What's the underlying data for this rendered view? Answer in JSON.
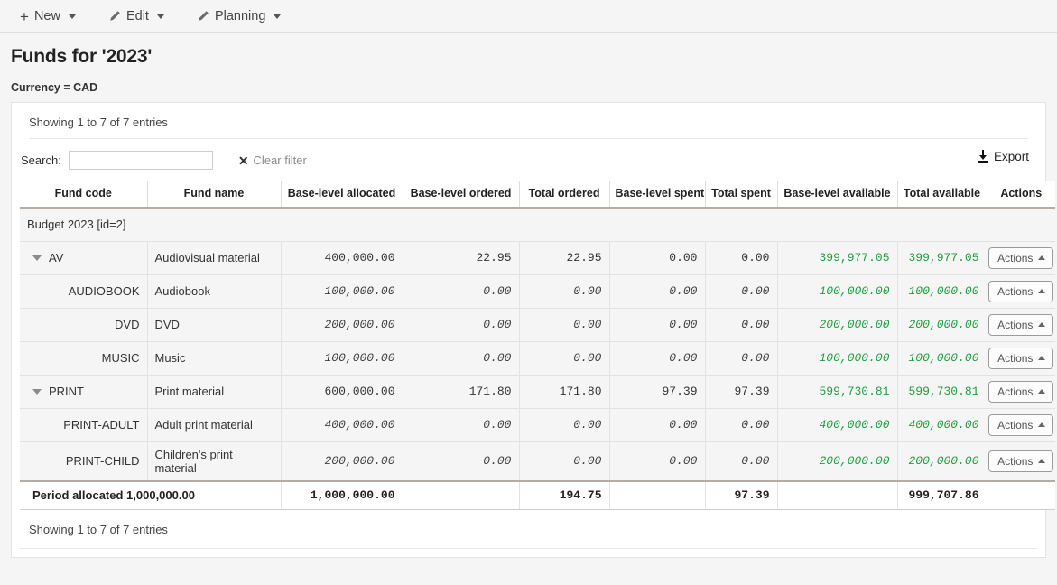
{
  "toolbar": {
    "items": [
      {
        "label": "New",
        "icon": "plus-icon"
      },
      {
        "label": "Edit",
        "icon": "pencil-icon"
      },
      {
        "label": "Planning",
        "icon": "pencil-icon"
      }
    ]
  },
  "header": {
    "title": "Funds for '2023'",
    "currency": "Currency = CAD"
  },
  "panel": {
    "showing_top": "Showing 1 to 7 of 7 entries",
    "showing_bottom": "Showing 1 to 7 of 7 entries",
    "search_label": "Search:",
    "search_value": "",
    "search_placeholder": "",
    "clear_filter": "Clear filter",
    "export": "Export"
  },
  "table": {
    "columns": [
      "Fund code",
      "Fund name",
      "Base-level allocated",
      "Base-level ordered",
      "Total ordered",
      "Base-level spent",
      "Total spent",
      "Base-level available",
      "Total available",
      "Actions"
    ],
    "group_label": "Budget 2023 [id=2]",
    "actions_label": "Actions",
    "rows": [
      {
        "code": "AV",
        "name": "Audiovisual material",
        "level": "parent",
        "base_allocated": "400,000.00",
        "base_ordered": "22.95",
        "total_ordered": "22.95",
        "base_spent": "0.00",
        "total_spent": "0.00",
        "base_available": "399,977.05",
        "total_available": "399,977.05"
      },
      {
        "code": "AUDIOBOOK",
        "name": "Audiobook",
        "level": "child",
        "base_allocated": "100,000.00",
        "base_ordered": "0.00",
        "total_ordered": "0.00",
        "base_spent": "0.00",
        "total_spent": "0.00",
        "base_available": "100,000.00",
        "total_available": "100,000.00"
      },
      {
        "code": "DVD",
        "name": "DVD",
        "level": "child",
        "base_allocated": "200,000.00",
        "base_ordered": "0.00",
        "total_ordered": "0.00",
        "base_spent": "0.00",
        "total_spent": "0.00",
        "base_available": "200,000.00",
        "total_available": "200,000.00"
      },
      {
        "code": "MUSIC",
        "name": "Music",
        "level": "child",
        "base_allocated": "100,000.00",
        "base_ordered": "0.00",
        "total_ordered": "0.00",
        "base_spent": "0.00",
        "total_spent": "0.00",
        "base_available": "100,000.00",
        "total_available": "100,000.00"
      },
      {
        "code": "PRINT",
        "name": "Print material",
        "level": "parent",
        "base_allocated": "600,000.00",
        "base_ordered": "171.80",
        "total_ordered": "171.80",
        "base_spent": "97.39",
        "total_spent": "97.39",
        "base_available": "599,730.81",
        "total_available": "599,730.81"
      },
      {
        "code": "PRINT-ADULT",
        "name": "Adult print material",
        "level": "child",
        "base_allocated": "400,000.00",
        "base_ordered": "0.00",
        "total_ordered": "0.00",
        "base_spent": "0.00",
        "total_spent": "0.00",
        "base_available": "400,000.00",
        "total_available": "400,000.00"
      },
      {
        "code": "PRINT-CHILD",
        "name": "Children's print material",
        "level": "child",
        "base_allocated": "200,000.00",
        "base_ordered": "0.00",
        "total_ordered": "0.00",
        "base_spent": "0.00",
        "total_spent": "0.00",
        "base_available": "200,000.00",
        "total_available": "200,000.00"
      }
    ],
    "footer": {
      "label": "Period allocated 1,000,000.00",
      "base_allocated": "1,000,000.00",
      "base_ordered": "",
      "total_ordered": "194.75",
      "base_spent": "",
      "total_spent": "97.39",
      "base_available": "",
      "total_available": "999,707.86"
    }
  },
  "colors": {
    "available_green": "#1f9d3f",
    "page_bg": "#f5f5f5",
    "panel_bg": "#ffffff"
  }
}
